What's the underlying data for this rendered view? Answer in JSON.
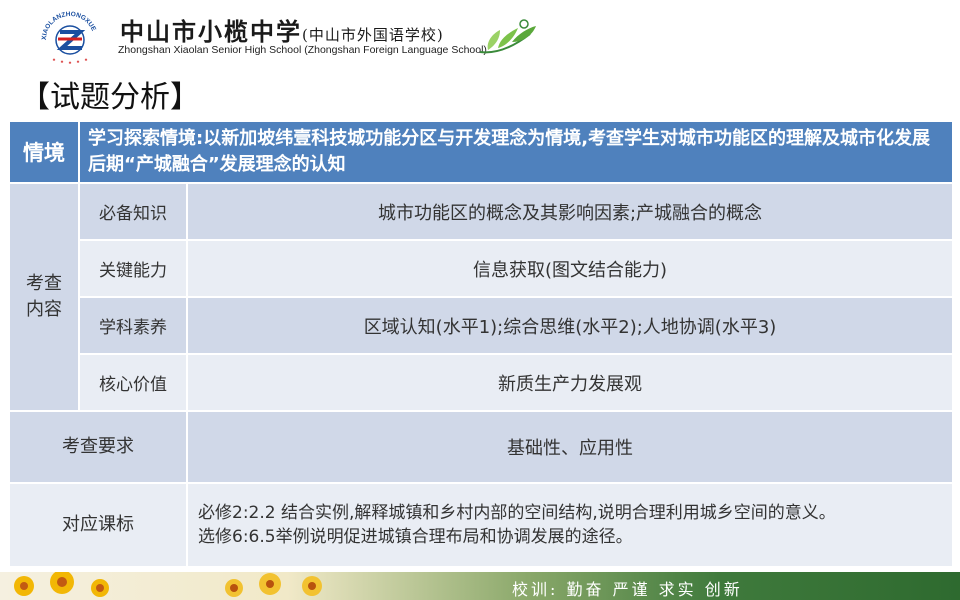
{
  "header": {
    "logo_text": "XIAOLANZHONGXUE",
    "school_name_cn": "中山市小榄中学",
    "school_name_cn_sub": "(中山市外国语学校)",
    "school_name_en": "Zhongshan Xiaolan Senior High School  (Zhongshan Foreign Language School)"
  },
  "section_title": "【试题分析】",
  "table": {
    "context_label": "情境",
    "context_text": "学习探索情境:以新加坡纬壹科技城功能分区与开发理念为情境,考查学生对城市功能区的理解及城市化发展后期“产城融合”发展理念的认知",
    "content_label": "考查内容",
    "content_rows": [
      {
        "label": "必备知识",
        "value": "城市功能区的概念及其影响因素;产城融合的概念"
      },
      {
        "label": "关键能力",
        "value": "信息获取(图文结合能力)"
      },
      {
        "label": "学科素养",
        "value": "区域认知(水平1);综合思维(水平2);人地协调(水平3)"
      },
      {
        "label": "核心价值",
        "value": "新质生产力发展观"
      }
    ],
    "requirement_label": "考查要求",
    "requirement_value": "基础性、应用性",
    "standard_label": "对应课标",
    "standard_lines": [
      "必修2:2.2 结合实例,解释城镇和乡村内部的空间结构,说明合理利用城乡空间的意义。",
      "选修6:6.5举例说明促进城镇合理布局和协调发展的途径。"
    ]
  },
  "footer": {
    "motto": "校训: 勤奋  严谨  求实  创新"
  },
  "colors": {
    "header_blue": "#4f81bd",
    "row_dark": "#d0d8e8",
    "row_light": "#e9edf4"
  }
}
